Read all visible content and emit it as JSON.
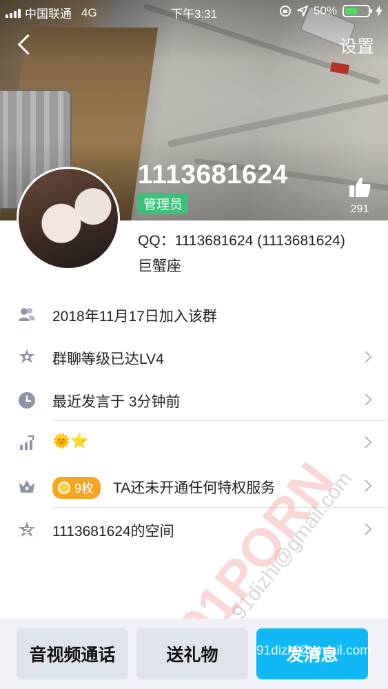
{
  "status_bar": {
    "carrier": "中国联通",
    "network": "4G",
    "time": "下午3:31",
    "battery": "50%"
  },
  "nav": {
    "settings_label": "设置"
  },
  "profile": {
    "display_name": "1113681624",
    "role": "管理员",
    "likes": "291",
    "qq_line": "QQ：1113681624 (1113681624)",
    "zodiac": "巨蟹座"
  },
  "info_rows": [
    {
      "icon": "group-members-icon",
      "text": "2018年11月17日加入该群"
    },
    {
      "icon": "level-star-icon",
      "text": "群聊等级已达LV4"
    },
    {
      "icon": "clock-icon",
      "text": "最近发言于 3分钟前"
    },
    {
      "icon": "growth-chart-icon",
      "text": "🌞⭐"
    },
    {
      "icon": "crown-icon",
      "badge": "9枚",
      "text": "TA还未开通任何特权服务"
    },
    {
      "icon": "space-star-icon",
      "text": "1113681624的空间"
    }
  ],
  "actions": {
    "call": "音视频通话",
    "gift": "送礼物",
    "message": "发消息"
  },
  "watermark": {
    "main": "91PORN",
    "email": "91dizhi@gmail.com"
  },
  "colors": {
    "accent_blue": "#12b7f5",
    "role_green": "#3cc07a",
    "badge_gold": "#f5a623"
  }
}
